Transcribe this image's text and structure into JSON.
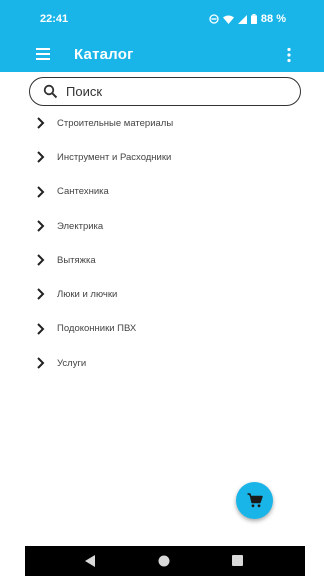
{
  "status_bar": {
    "time": "22:41",
    "battery": "88 %",
    "icons": [
      "do-not-disturb-icon",
      "wifi-icon",
      "signal-icon",
      "battery-icon"
    ]
  },
  "app_bar": {
    "title": "Каталог",
    "menu_icon": "hamburger-menu-icon",
    "more_icon": "more-vertical-icon",
    "color": "#1ab5e8"
  },
  "search": {
    "placeholder": "Поиск",
    "value": ""
  },
  "categories": [
    {
      "label": "Строительные материалы"
    },
    {
      "label": "Инструмент и Расходники"
    },
    {
      "label": "Сантехника"
    },
    {
      "label": "Электрика"
    },
    {
      "label": "Вытяжка"
    },
    {
      "label": "Люки и лючки"
    },
    {
      "label": "Подоконники ПВХ"
    },
    {
      "label": "Услуги"
    }
  ],
  "fab": {
    "icon": "cart-icon",
    "color": "#1ab5e8"
  },
  "nav_bar": {
    "icons": [
      "back-icon",
      "home-icon",
      "recents-icon"
    ]
  }
}
